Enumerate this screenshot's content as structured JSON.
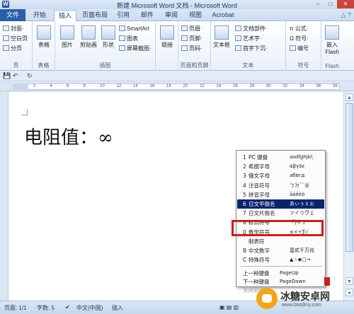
{
  "window": {
    "title": "新建 Microsoft Word 文档 - Microsoft Word",
    "app_icon": "W",
    "controls": [
      "–",
      "□",
      "✕"
    ]
  },
  "tabs": [
    "文件",
    "开始",
    "插入",
    "页面布局",
    "引用",
    "邮件",
    "审阅",
    "视图",
    "Acrobat"
  ],
  "ribbon": {
    "pages_group": {
      "items": [
        "封面·",
        "空白页",
        "分页"
      ],
      "label": "页"
    },
    "table_group": {
      "button": "表格",
      "label": "表格"
    },
    "illustrations_group": {
      "buttons": [
        "图片",
        "剪贴画",
        "形状"
      ],
      "side_items": [
        "SmartArt",
        "图表",
        "屏幕截图·"
      ],
      "label": "插图"
    },
    "links_group": {
      "button": "链接"
    },
    "header_footer_group": {
      "items": [
        "页眉·",
        "页脚·",
        "页码·"
      ],
      "label": "页眉和页脚"
    },
    "text_group": {
      "button": "文本框",
      "items": [
        "文档部件·",
        "艺术字·",
        "首字下沉·"
      ],
      "label": "文本"
    },
    "symbols_group": {
      "items": [
        "π 公式·",
        "Ω 符号·",
        "编号"
      ],
      "label": "符号"
    },
    "flash_group": {
      "button": "嵌入Flash",
      "label": "Flash"
    }
  },
  "qat": {
    "save_icon": "💾",
    "undo": "↶",
    "redo": "↻"
  },
  "ruler_marks": [
    "2",
    "4",
    "6",
    "8",
    "10",
    "12",
    "14",
    "16",
    "18",
    "20",
    "22",
    "24",
    "26",
    "28",
    "30",
    "32",
    "34",
    "36",
    "38"
  ],
  "document": {
    "text": "电阻值：∞"
  },
  "soft_keyboard_menu": {
    "items": [
      {
        "num": "1",
        "name": "PC 键盘",
        "preview": "asdfghjkl;"
      },
      {
        "num": "2",
        "name": "希腊字母",
        "preview": "αβγδε"
      },
      {
        "num": "3",
        "name": "俄文字母",
        "preview": "абвгд"
      },
      {
        "num": "4",
        "name": "注音符号",
        "preview": "ㄅㄉˇˋㄓ"
      },
      {
        "num": "5",
        "name": "拼音字母",
        "preview": "āáěèó"
      },
      {
        "num": "6",
        "name": "日文平假名",
        "preview": "あぃぅぇぉ"
      },
      {
        "num": "7",
        "name": "日文片假名",
        "preview": "ァイゥヴェ"
      },
      {
        "num": "8",
        "name": "标点符号",
        "preview": "『|々·」"
      },
      {
        "num": "0",
        "name": "数学符号",
        "preview": "±×÷∑√"
      },
      {
        "num": "",
        "name": "制表符",
        "preview": ""
      },
      {
        "num": "B",
        "name": "中文数字",
        "preview": "壹贰千万兆"
      },
      {
        "num": "C",
        "name": "特殊符号",
        "preview": "▲☆◆□→"
      }
    ],
    "selected_index": 5,
    "footer": [
      {
        "name": "上一种键盘",
        "shortcut": "PageUp"
      },
      {
        "name": "下一种键盘",
        "shortcut": "PageDown"
      },
      {
        "name": "关闭软键盘",
        "shortcut": ""
      }
    ]
  },
  "status_bar": {
    "page": "页面: 1/1",
    "words": "字数: 5",
    "language": "中文(中国)",
    "mode": "插入"
  },
  "watermark": {
    "brand": "冰糖安卓网",
    "url": "www.btxtdmy.com"
  },
  "colors": {
    "file_tab": "#2a5fa8",
    "menu_selection": "#0a246a",
    "highlight_box": "#c8201d"
  }
}
